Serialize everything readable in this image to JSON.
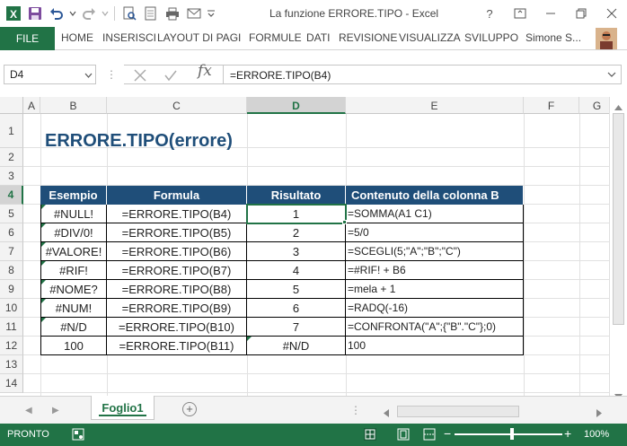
{
  "window": {
    "title": "La funzione ERRORE.TIPO - Excel"
  },
  "ribbon": {
    "file_tab": "FILE",
    "tabs": [
      "HOME",
      "INSERISCI",
      "LAYOUT DI PAGI",
      "FORMULE",
      "DATI",
      "REVISIONE",
      "VISUALIZZA",
      "SVILUPPO"
    ],
    "user": "Simone S..."
  },
  "formula_bar": {
    "name_box": "D4",
    "formula": "=ERRORE.TIPO(B4)",
    "fx_label": "fx"
  },
  "grid": {
    "columns": [
      "A",
      "B",
      "C",
      "D",
      "E",
      "F",
      "G"
    ],
    "selected_column": "D",
    "rows": [
      "1",
      "2",
      "3",
      "4",
      "5",
      "6",
      "7",
      "8",
      "9",
      "10",
      "11",
      "12",
      "13",
      "14"
    ],
    "selected_row": "4"
  },
  "sheet": {
    "title": "ERRORE.TIPO(errore)",
    "headers": [
      "Esempio",
      "Formula",
      "Risultato",
      "Contenuto della colonna B"
    ],
    "rows": [
      [
        "#NULL!",
        "=ERRORE.TIPO(B4)",
        "1",
        "=SOMMA(A1 C1)"
      ],
      [
        "#DIV/0!",
        "=ERRORE.TIPO(B5)",
        "2",
        "=5/0"
      ],
      [
        "#VALORE!",
        "=ERRORE.TIPO(B6)",
        "3",
        "=SCEGLI(5;\"A\";\"B\";\"C\")"
      ],
      [
        "#RIF!",
        "=ERRORE.TIPO(B7)",
        "4",
        "=#RIF! + B6"
      ],
      [
        "#NOME?",
        "=ERRORE.TIPO(B8)",
        "5",
        "=mela + 1"
      ],
      [
        "#NUM!",
        "=ERRORE.TIPO(B9)",
        "6",
        "=RADQ(-16)"
      ],
      [
        "#N/D",
        "=ERRORE.TIPO(B10)",
        "7",
        "=CONFRONTA(\"A\";{\"B\".\"C\"};0)"
      ],
      [
        "100",
        "=ERRORE.TIPO(B11)",
        "#N/D",
        "100"
      ]
    ]
  },
  "sheet_tabs": {
    "active": "Foglio1",
    "add_label": "+"
  },
  "status_bar": {
    "ready": "PRONTO",
    "zoom_out": "−",
    "zoom_in": "+",
    "zoom": "100%"
  },
  "colors": {
    "accent": "#217346",
    "table_header": "#1f4e79",
    "title": "#1f4e79"
  }
}
